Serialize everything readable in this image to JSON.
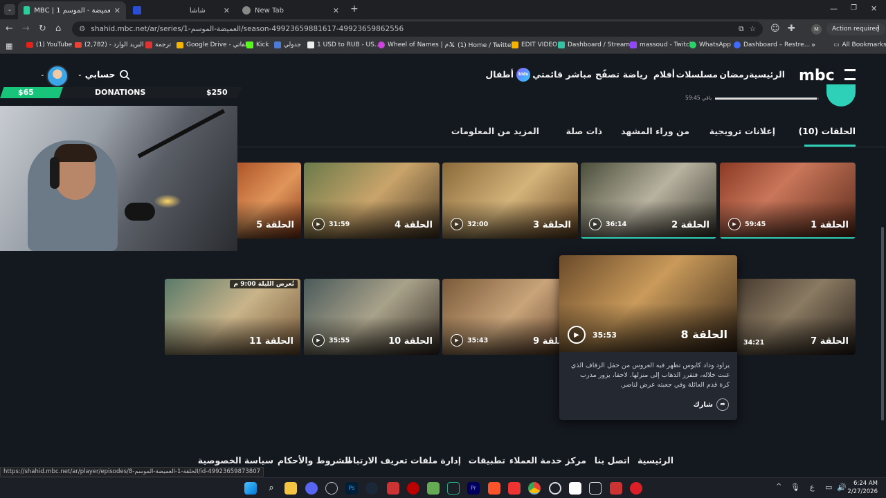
{
  "browser": {
    "tabs": [
      {
        "title": "MBC | 1 شاهد العميضة - الموسم",
        "active": true
      },
      {
        "title": "شاشا",
        "active": false
      },
      {
        "title": "New Tab",
        "active": false
      }
    ],
    "new_tab": "+",
    "url": "shahid.mbc.net/ar/series/1-العميضة-الموسم/season-49923659881617-49923659862556",
    "action_required": "Action required",
    "profile_initial": "M",
    "bookmarks": [
      "(1) YouTube",
      "البريد الوارد - (2,782)",
      "ترجمة",
      "Google Drive - ملفاتي",
      "Kick",
      "جدولي",
      "1 USD to RUB - US...",
      "Wheel of Names | م...",
      "(1) Home / Twitter",
      "EDIT VIDEO",
      "Dashboard / Stream...",
      "massoud - Twitch",
      "WhatsApp",
      "Dashboard – Restre..."
    ],
    "all_bookmarks": "All Bookmarks"
  },
  "site": {
    "logo": "mbc",
    "nav": [
      "الرئيسية",
      "رمضان",
      "مسلسلات",
      "أفلام",
      "رياضة",
      "تصفّح",
      "مباشر",
      "قائمتي",
      "أطفال"
    ],
    "kids_badge": "kids",
    "account": "حسابي",
    "progress_text": "59:45 باقي",
    "progress_fraction": 0.98,
    "section_tabs": [
      "الحلقات (10)",
      "إعلانات ترويجية",
      "من وراء المشهد",
      "ذات صلة",
      "المزيد من المعلومات"
    ],
    "row1": [
      {
        "title": "الحلقة 1",
        "duration": "59:45"
      },
      {
        "title": "الحلقة 2",
        "duration": "36:14"
      },
      {
        "title": "الحلقة 3",
        "duration": "32:00"
      },
      {
        "title": "الحلقة 4",
        "duration": "31:59"
      },
      {
        "title": "الحلقة 5",
        "duration": ""
      }
    ],
    "row2": [
      {
        "title": "الحلقة 7",
        "duration": "34:21"
      },
      {
        "title": "الحلقة 9",
        "duration": "35:43"
      },
      {
        "title": "الحلقة 10",
        "duration": "35:55"
      },
      {
        "title": "الحلقة 11",
        "duration": "",
        "badge": "تُعرض الليلة 9:00 م"
      }
    ],
    "hover_card": {
      "title": "الحلقة 8",
      "duration": "35:53",
      "description": "يراود وداد كابوس تظهر فيه العروس من حفل الزفاف الذي غنت خلاله، فتقرر الذهاب إلى منزلها. لاحقا، يزور مدرب كرة قدم العائلة وفي جعبته عرض لناصر.",
      "share": "شارك"
    },
    "footer": [
      "الرئيسية",
      "اتصل بنا",
      "مركز خدمة العملاء",
      "تطبيقات",
      "إدارة ملفات تعريف الارتباط",
      "الشروط والأحكام",
      "سياسة الخصوصية"
    ],
    "status_url": "https://shahid.mbc.net/ar/player/episodes/8-الحلقة-1-العميضة-الموسم/id-49923659873807"
  },
  "overlay": {
    "left_amount": "$65",
    "label": "DONATIONS",
    "right_amount": "$250",
    "progress_fraction": 0.26
  },
  "taskbar": {
    "time": "6:24 AM",
    "date": "2/27/2026",
    "lang": "ع"
  }
}
